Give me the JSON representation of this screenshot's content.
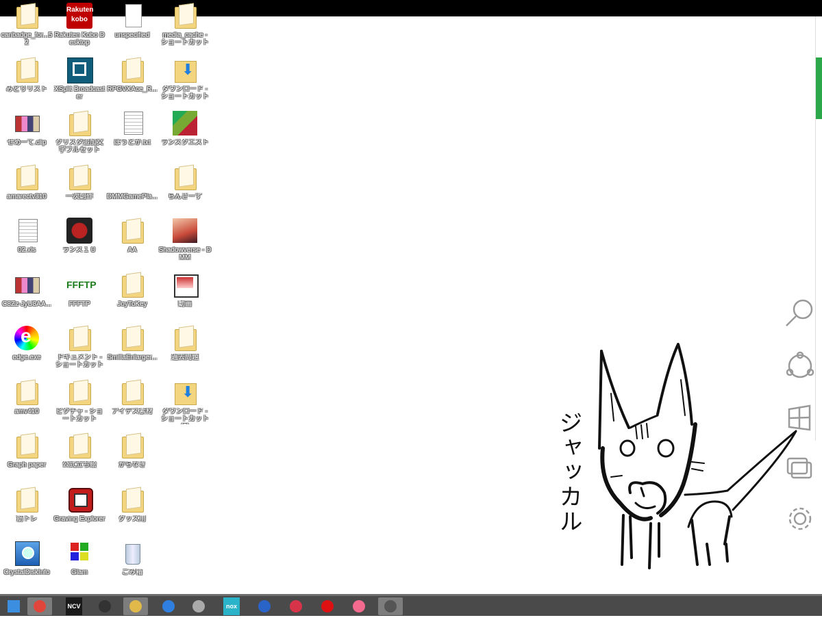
{
  "desktop": {
    "icons": [
      {
        "label": "canbadge_for...52"
      },
      {
        "label": "Rakuten Kobo Desktop",
        "logo_text": "Rakuten kobo"
      },
      {
        "label": "unspecified"
      },
      {
        "label": "media_cache - ショートカット"
      },
      {
        "label": "みどりリスト"
      },
      {
        "label": "XSplit Broadcaster"
      },
      {
        "label": "RPGVXAce_R..."
      },
      {
        "label": "ダウンロード - ショートカット"
      },
      {
        "label": "せめーて.clip"
      },
      {
        "label": "クリスタ追加文字フルセット"
      },
      {
        "label": "ぼうとか.txt"
      },
      {
        "label": "ランスクエスト"
      },
      {
        "label": "amarectv310"
      },
      {
        "label": "一次創作"
      },
      {
        "label": "DMMGamePla..."
      },
      {
        "label": "らんさーず"
      },
      {
        "label": "02.xls"
      },
      {
        "label": "ランス１０"
      },
      {
        "label": "AA"
      },
      {
        "label": "Shadowverse - DMM"
      },
      {
        "label": "C8Zz-JyU8AA..."
      },
      {
        "label": "FFFTP",
        "logo_text": "FFFTP"
      },
      {
        "label": "JoyToKey"
      },
      {
        "label": "動画"
      },
      {
        "label": "edge.exe"
      },
      {
        "label": "ドキュメント - ショートカット"
      },
      {
        "label": "SmillaEnlarger..."
      },
      {
        "label": "過去問題"
      },
      {
        "label": "amv410"
      },
      {
        "label": "ピクチャ - ショートカット"
      },
      {
        "label": "アイデス素材"
      },
      {
        "label": "ダウンロード - ショートカット (2)"
      },
      {
        "label": "Graph paper"
      },
      {
        "label": "公式立ち絵"
      },
      {
        "label": "がらなき"
      },
      {
        "label": "筋トレ"
      },
      {
        "label": "Graving Explorer"
      },
      {
        "label": "グッズ用"
      },
      {
        "label": "CrystalDiskInfo"
      },
      {
        "label": "Glam"
      },
      {
        "label": "ごみ箱"
      }
    ]
  },
  "drawing": {
    "caption": "ジャッカル"
  },
  "charms": [
    {
      "name": "search-icon"
    },
    {
      "name": "share-icon"
    },
    {
      "name": "windows-start-icon"
    },
    {
      "name": "devices-icon"
    },
    {
      "name": "settings-gear-icon"
    }
  ],
  "taskbar": {
    "items": [
      {
        "name": "start-button",
        "icon": "windows-logo-icon"
      },
      {
        "name": "taskbar-chrome",
        "icon": "chrome-icon"
      },
      {
        "name": "taskbar-ncv",
        "icon": "ncv-icon",
        "text": "NCV"
      },
      {
        "name": "taskbar-obs",
        "icon": "obs-icon"
      },
      {
        "name": "taskbar-explorer",
        "icon": "folder-icon"
      },
      {
        "name": "taskbar-g-app",
        "icon": "g-app-icon"
      },
      {
        "name": "taskbar-swirl-app",
        "icon": "swirl-icon"
      },
      {
        "name": "taskbar-nox",
        "icon": "nox-icon",
        "text": "nox"
      },
      {
        "name": "taskbar-thunderbird",
        "icon": "thunderbird-icon"
      },
      {
        "name": "taskbar-cube-app",
        "icon": "cube-icon"
      },
      {
        "name": "taskbar-opera",
        "icon": "opera-icon"
      },
      {
        "name": "taskbar-lips-app",
        "icon": "lips-icon"
      },
      {
        "name": "taskbar-clip-studio",
        "icon": "clip-studio-icon"
      }
    ]
  },
  "colors": {
    "taskbar_bg": "#4a4a4a",
    "top_bar": "#000000",
    "scroll_accent": "#2aa84a"
  }
}
